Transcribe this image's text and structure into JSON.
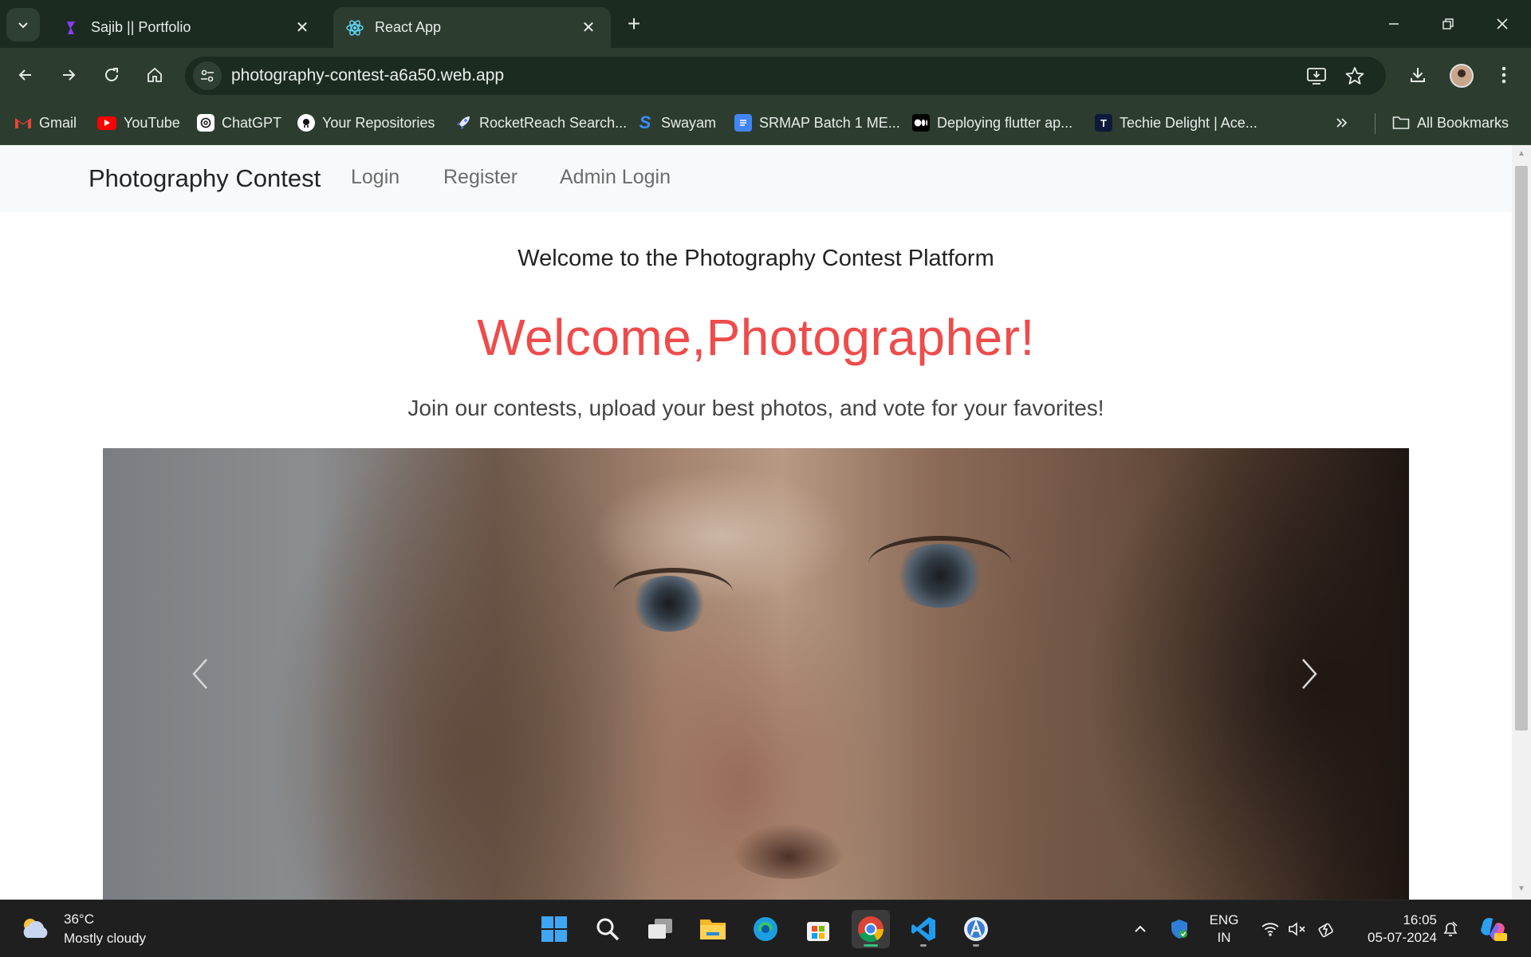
{
  "browser": {
    "tabs": [
      {
        "title": "Sajib || Portfolio",
        "active": false
      },
      {
        "title": "React App",
        "active": true
      }
    ],
    "url": "photography-contest-a6a50.web.app",
    "bookmarks": [
      {
        "label": "Gmail",
        "icon": "gmail-icon"
      },
      {
        "label": "YouTube",
        "icon": "youtube-icon"
      },
      {
        "label": "ChatGPT",
        "icon": "chatgpt-icon"
      },
      {
        "label": "Your Repositories",
        "icon": "github-icon"
      },
      {
        "label": "RocketReach Search...",
        "icon": "rocket-icon"
      },
      {
        "label": "Swayam",
        "icon": "swayam-icon"
      },
      {
        "label": "SRMAP Batch 1 ME...",
        "icon": "docs-icon"
      },
      {
        "label": "Deploying flutter ap...",
        "icon": "medium-icon"
      },
      {
        "label": "Techie Delight | Ace...",
        "icon": "techie-delight-icon"
      }
    ],
    "all_bookmarks": "All Bookmarks"
  },
  "page": {
    "navbar": {
      "brand": "Photography Contest",
      "links": [
        "Login",
        "Register",
        "Admin Login"
      ]
    },
    "heading": "Welcome to the Photography Contest Platform",
    "welcome": "Welcome,Photographer!",
    "subtitle": "Join our contests, upload your best photos, and vote for your favorites!"
  },
  "taskbar": {
    "weather": {
      "temp": "36°C",
      "condition": "Mostly cloudy"
    },
    "language": {
      "line1": "ENG",
      "line2": "IN"
    },
    "time": "16:05",
    "date": "05-07-2024"
  },
  "colors": {
    "accent_welcome": "#ef4b4b",
    "chrome_dark": "#1c2b20",
    "chrome_toolbar": "#2c3d30",
    "taskbar": "#1f1f1f"
  }
}
